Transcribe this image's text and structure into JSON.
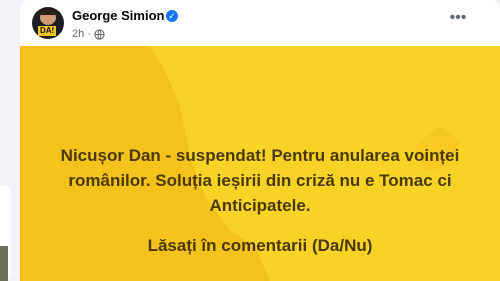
{
  "post": {
    "author": "George Simion",
    "time": "2h",
    "separator": "·",
    "avatar_tag": "DA!",
    "headline": "Nicușor Dan - suspendat! Pentru anularea voinței românilor. Soluția ieșirii din criză nu e Tomac ci Anticipatele.",
    "cta": "Lăsați în comentarii (Da/Nu)"
  },
  "icons": {
    "verified": "verified-badge-icon",
    "audience": "globe-icon",
    "more": "more-options-icon"
  },
  "colors": {
    "banner": "#f5c21b",
    "map": "#f9d226",
    "text": "#4b3a08",
    "verified": "#1877f2"
  }
}
